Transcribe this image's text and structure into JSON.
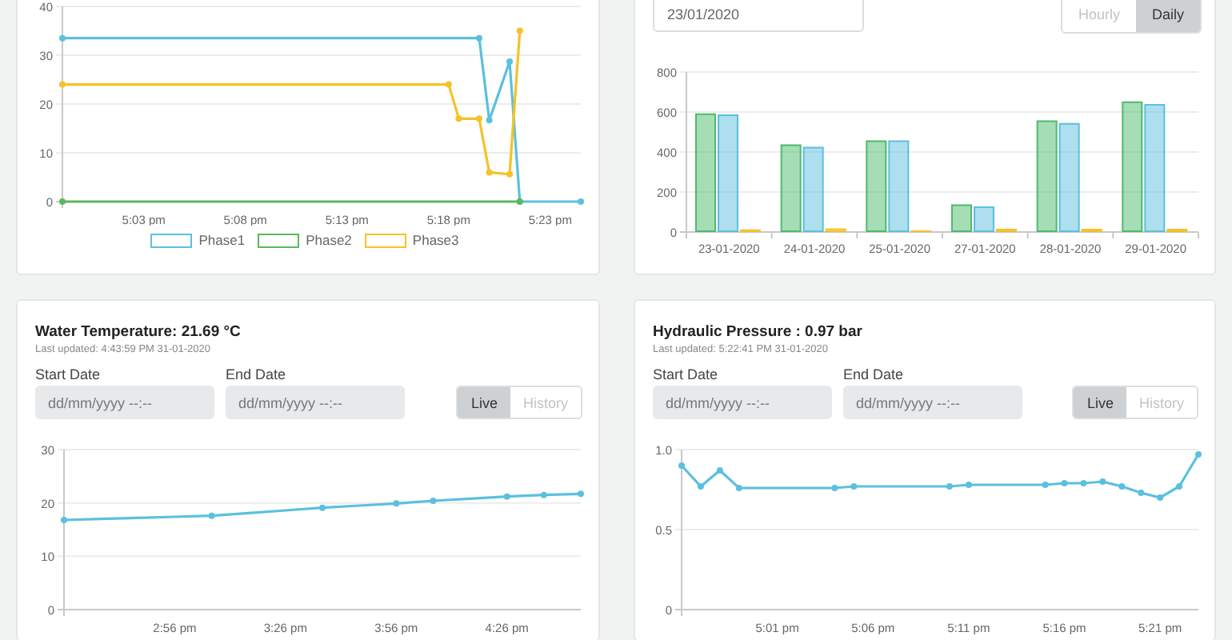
{
  "rows": [
    {
      "panels": [
        {
          "kind": "phase_chart",
          "chart_data": {
            "type": "line",
            "grid": true,
            "categories": [
              null,
              null,
              null,
              null,
              null,
              null,
              null,
              null,
              "5:03 pm",
              null,
              null,
              null,
              null,
              null,
              null,
              null,
              null,
              null,
              "5:08 pm",
              null,
              null,
              null,
              null,
              null,
              null,
              null,
              null,
              null,
              "5:13 pm",
              null,
              null,
              null,
              null,
              null,
              null,
              null,
              null,
              null,
              "5:18 pm",
              null,
              null,
              null,
              null,
              null,
              null,
              null,
              null,
              null,
              "5:23 pm",
              null,
              null,
              null
            ],
            "ylim": [
              0,
              40
            ],
            "yticks": [
              0,
              10,
              20,
              30,
              40
            ],
            "series": [
              {
                "name": "Phase1",
                "color": "#5bc0de",
                "marker": true,
                "values": [
                  33.5,
                  33.5,
                  33.5,
                  33.5,
                  33.5,
                  33.5,
                  33.5,
                  33.5,
                  33.5,
                  33.5,
                  33.5,
                  33.5,
                  33.5,
                  33.5,
                  33.5,
                  33.5,
                  33.5,
                  33.5,
                  33.5,
                  33.5,
                  33.5,
                  33.5,
                  33.5,
                  33.5,
                  33.5,
                  33.5,
                  33.5,
                  33.5,
                  33.5,
                  33.5,
                  33.5,
                  33.5,
                  33.5,
                  33.5,
                  33.5,
                  33.5,
                  33.5,
                  33.5,
                  33.5,
                  33.5,
                  33.5,
                  33.5,
                  16.7,
                  22.7,
                  28.7,
                  0,
                  0,
                  0,
                  0,
                  0,
                  0,
                  0
                ]
              },
              {
                "name": "Phase2",
                "color": "#5cb85c",
                "marker": true,
                "values": [
                  0,
                  0,
                  0,
                  0,
                  0,
                  0,
                  0,
                  0,
                  0,
                  0,
                  0,
                  0,
                  0,
                  0,
                  0,
                  0,
                  0,
                  0,
                  0,
                  0,
                  0,
                  0,
                  0,
                  0,
                  0,
                  0,
                  0,
                  0,
                  0,
                  0,
                  0,
                  0,
                  0,
                  0,
                  0,
                  0,
                  0,
                  0,
                  0,
                  0,
                  0,
                  0,
                  0,
                  0,
                  0,
                  0,
                  null,
                  null,
                  null,
                  null,
                  null,
                  null
                ]
              },
              {
                "name": "Phase3",
                "color": "#f5c227",
                "marker": true,
                "values": [
                  24,
                  24,
                  24,
                  24,
                  24,
                  24,
                  24,
                  24,
                  24,
                  24,
                  24,
                  24,
                  24,
                  24,
                  24,
                  24,
                  24,
                  24,
                  24,
                  24,
                  24,
                  24,
                  24,
                  24,
                  24,
                  24,
                  24,
                  24,
                  24,
                  24,
                  24,
                  24,
                  24,
                  24,
                  24,
                  24,
                  24,
                  24,
                  24,
                  17,
                  17,
                  17,
                  6,
                  5.8,
                  5.6,
                  35,
                  null,
                  null,
                  null,
                  null,
                  null,
                  null
                ]
              }
            ]
          }
        },
        {
          "kind": "daily_chart",
          "date_field": {
            "value": "23/01/2020"
          },
          "modes": [
            {
              "label": "Hourly",
              "selected": false
            },
            {
              "label": "Daily",
              "selected": true
            }
          ],
          "chart_data": {
            "type": "bar",
            "grid": true,
            "categories": [
              "23-01-2020",
              "24-01-2020",
              "25-01-2020",
              "27-01-2020",
              "28-01-2020",
              "29-01-2020"
            ],
            "ylim": [
              0,
              800
            ],
            "yticks": [
              0,
              200,
              400,
              600,
              800
            ],
            "series": [
              {
                "color": "#4cbb6c",
                "values": [
                  585,
                  430,
                  450,
                  130,
                  550,
                  645
                ]
              },
              {
                "color": "#5bc0de",
                "values": [
                  580,
                  418,
                  450,
                  120,
                  537,
                  632
                ]
              },
              {
                "color": "#f5c227",
                "values": [
                  5,
                  10,
                  0,
                  8,
                  8,
                  8
                ]
              }
            ]
          }
        }
      ]
    },
    {
      "panels": [
        {
          "kind": "sensor",
          "title": "Water Temperature: 21.69 °C",
          "updated": "Last updated: 4:43:59 PM 31-01-2020",
          "start_date": {
            "label": "Start Date",
            "placeholder": "dd/mm/yyyy --:--"
          },
          "end_date": {
            "label": "End Date",
            "placeholder": "dd/mm/yyyy --:--"
          },
          "modes": [
            {
              "label": "Live",
              "selected": true
            },
            {
              "label": "History",
              "selected": false
            }
          ],
          "chart_data": {
            "type": "line",
            "grid": true,
            "categories": [
              null,
              null,
              null,
              "2:56 pm",
              null,
              null,
              "3:26 pm",
              null,
              null,
              "3:56 pm",
              null,
              null,
              "4:26 pm",
              null,
              null
            ],
            "ylim": [
              0,
              30
            ],
            "yticks": [
              0,
              10,
              20,
              30
            ],
            "series": [
              {
                "color": "#5bc0de",
                "marker": true,
                "values": [
                  16.8,
                  17,
                  17.2,
                  17.4,
                  17.6,
                  18.1,
                  18.6,
                  19.1,
                  19.5,
                  19.9,
                  20.4,
                  20.8,
                  21.2,
                  21.5,
                  21.7
                ]
              }
            ]
          }
        },
        {
          "kind": "sensor",
          "title": "Hydraulic Pressure : 0.97 bar",
          "updated": "Last updated: 5:22:41 PM 31-01-2020",
          "start_date": {
            "label": "Start Date",
            "placeholder": "dd/mm/yyyy --:--"
          },
          "end_date": {
            "label": "End Date",
            "placeholder": "dd/mm/yyyy --:--"
          },
          "modes": [
            {
              "label": "Live",
              "selected": true
            },
            {
              "label": "History",
              "selected": false
            }
          ],
          "chart_data": {
            "type": "line",
            "grid": true,
            "categories": [
              null,
              null,
              null,
              null,
              null,
              "5:01 pm",
              null,
              null,
              null,
              null,
              "5:06 pm",
              null,
              null,
              null,
              null,
              "5:11 pm",
              null,
              null,
              null,
              null,
              "5:16 pm",
              null,
              null,
              null,
              null,
              "5:21 pm",
              null,
              null
            ],
            "ylim": [
              0,
              1
            ],
            "yticks": [
              {
                "value": 0,
                "label": "0"
              },
              {
                "value": 0.5,
                "label": "0.5"
              },
              {
                "value": 1,
                "label": "1.0"
              }
            ],
            "series": [
              {
                "color": "#5bc0de",
                "marker": true,
                "values": [
                  0.9,
                  0.77,
                  0.87,
                  0.76,
                  0.76,
                  0.76,
                  0.76,
                  0.76,
                  0.76,
                  0.77,
                  0.77,
                  0.77,
                  0.77,
                  0.77,
                  0.77,
                  0.78,
                  0.78,
                  0.78,
                  0.78,
                  0.78,
                  0.79,
                  0.79,
                  0.8,
                  0.77,
                  0.73,
                  0.7,
                  0.77,
                  0.97
                ]
              }
            ]
          }
        }
      ]
    }
  ]
}
